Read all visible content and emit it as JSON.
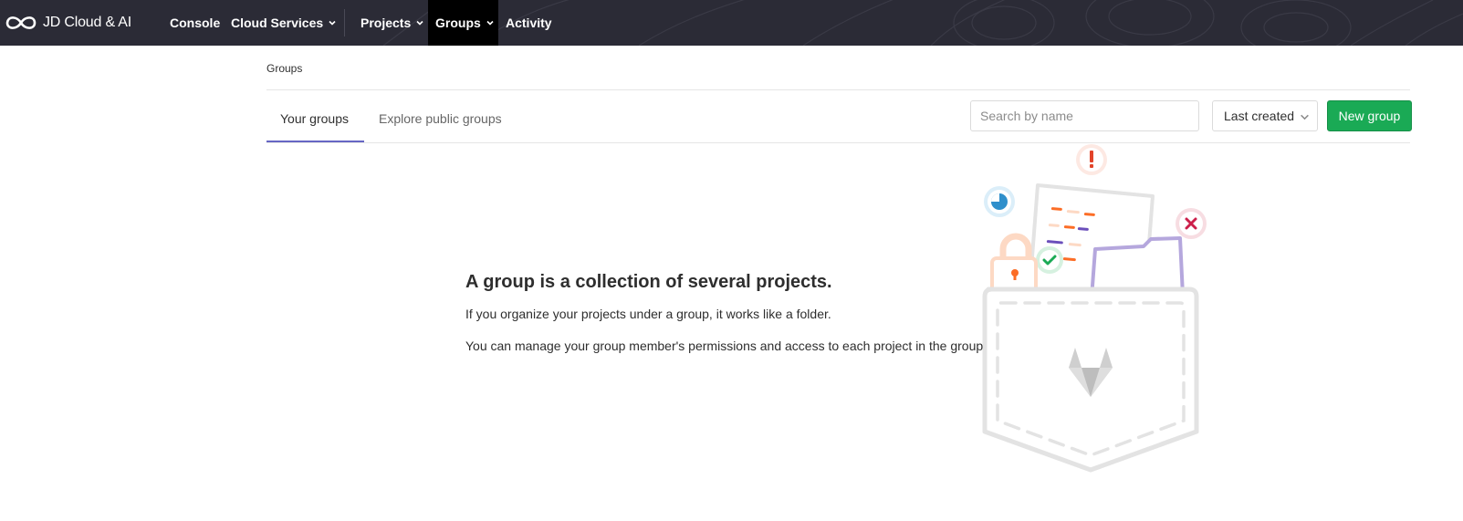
{
  "nav": {
    "brand": "JD Cloud & AI",
    "items": [
      {
        "label": "Console"
      },
      {
        "label": "Cloud Services"
      },
      {
        "label": "Projects"
      },
      {
        "label": "Groups"
      },
      {
        "label": "Activity"
      }
    ],
    "active": "Groups"
  },
  "breadcrumb": "Groups",
  "tabs": [
    {
      "label": "Your groups",
      "active": true
    },
    {
      "label": "Explore public groups",
      "active": false
    }
  ],
  "search": {
    "placeholder": "Search by name",
    "value": ""
  },
  "sort": {
    "selected": "Last created"
  },
  "new_group_label": "New group",
  "empty_state": {
    "title": "A group is a collection of several projects.",
    "line1": "If you organize your projects under a group, it works like a folder.",
    "line2": "You can manage your group member's permissions and access to each project in the group."
  },
  "colors": {
    "nav_bg": "#2b2b36",
    "active_nav_bg": "#000000",
    "tab_underline": "#6666c4",
    "primary_button": "#1aaa55"
  },
  "icons": [
    "brand-logo-icon",
    "chevron-down-icon",
    "gitlab-fox-icon"
  ]
}
